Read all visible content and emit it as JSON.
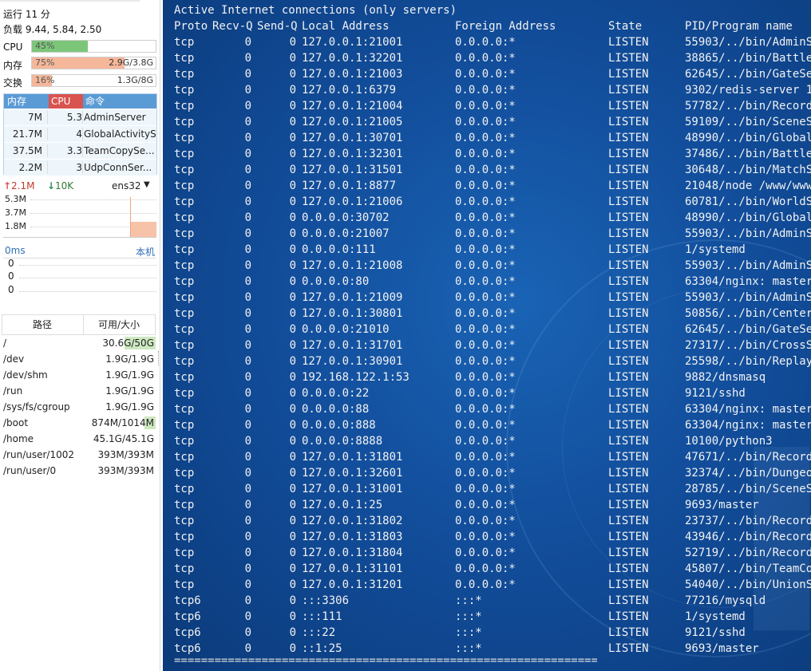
{
  "system": {
    "uptime_label": "运行 11 分",
    "load_label": "负载 9.44, 5.84, 2.50",
    "cpu": {
      "label": "CPU",
      "percent_text": "45%",
      "fraction": 0.45,
      "color": "#7cc67a"
    },
    "memory": {
      "label": "内存",
      "percent_text": "75%",
      "fraction": 0.75,
      "amount": "2.9G/3.8G",
      "color": "#f5b79a"
    },
    "swap": {
      "label": "交换",
      "percent_text": "16%",
      "fraction": 0.16,
      "amount": "1.3G/8G",
      "color": "#f5b79a"
    }
  },
  "processes": {
    "headers": [
      "内存",
      "CPU",
      "命令"
    ],
    "rows": [
      {
        "mem": "7M",
        "cpu": "5.3",
        "cmd": "AdminServer"
      },
      {
        "mem": "21.7M",
        "cpu": "4",
        "cmd": "GlobalActivityS"
      },
      {
        "mem": "37.5M",
        "cpu": "3.3",
        "cmd": "TeamCopySe..."
      },
      {
        "mem": "2.2M",
        "cpu": "3",
        "cmd": "UdpConnSer..."
      }
    ]
  },
  "network": {
    "up": "2.1M",
    "down": "10K",
    "interface": "ens32",
    "scale_labels": [
      "5.3M",
      "3.7M",
      "1.8M"
    ]
  },
  "latency": {
    "value": "0ms",
    "target": "本机",
    "rows": [
      "0",
      "0",
      "0"
    ]
  },
  "disk": {
    "headers": [
      "路径",
      "可用/大小"
    ],
    "rows": [
      {
        "path": "/",
        "size": "30.6G/50G",
        "used_fraction": 0.39
      },
      {
        "path": "/dev",
        "size": "1.9G/1.9G",
        "used_fraction": 0
      },
      {
        "path": "/dev/shm",
        "size": "1.9G/1.9G",
        "used_fraction": 0
      },
      {
        "path": "/run",
        "size": "1.9G/1.9G",
        "used_fraction": 0
      },
      {
        "path": "/sys/fs/cgroup",
        "size": "1.9G/1.9G",
        "used_fraction": 0
      },
      {
        "path": "/boot",
        "size": "874M/1014M",
        "used_fraction": 0.14
      },
      {
        "path": "/home",
        "size": "45.1G/45.1G",
        "used_fraction": 0
      },
      {
        "path": "/run/user/1002",
        "size": "393M/393M",
        "used_fraction": 0
      },
      {
        "path": "/run/user/0",
        "size": "393M/393M",
        "used_fraction": 0
      }
    ]
  },
  "terminal": {
    "title": "Active Internet connections (only servers)",
    "headers": [
      "Proto",
      "Recv-Q",
      "Send-Q",
      "Local Address",
      "Foreign Address",
      "State",
      "PID/Program name"
    ],
    "rows": [
      [
        "tcp",
        "0",
        "0",
        "127.0.0.1:21001",
        "0.0.0.0:*",
        "LISTEN",
        "55903/../bin/AdminS"
      ],
      [
        "tcp",
        "0",
        "0",
        "127.0.0.1:32201",
        "0.0.0.0:*",
        "LISTEN",
        "38865/../bin/Battle"
      ],
      [
        "tcp",
        "0",
        "0",
        "127.0.0.1:21003",
        "0.0.0.0:*",
        "LISTEN",
        "62645/../bin/GateSe"
      ],
      [
        "tcp",
        "0",
        "0",
        "127.0.0.1:6379",
        "0.0.0.0:*",
        "LISTEN",
        "9302/redis-server 1"
      ],
      [
        "tcp",
        "0",
        "0",
        "127.0.0.1:21004",
        "0.0.0.0:*",
        "LISTEN",
        "57782/../bin/Record"
      ],
      [
        "tcp",
        "0",
        "0",
        "127.0.0.1:21005",
        "0.0.0.0:*",
        "LISTEN",
        "59109/../bin/SceneS"
      ],
      [
        "tcp",
        "0",
        "0",
        "127.0.0.1:30701",
        "0.0.0.0:*",
        "LISTEN",
        "48990/../bin/Global"
      ],
      [
        "tcp",
        "0",
        "0",
        "127.0.0.1:32301",
        "0.0.0.0:*",
        "LISTEN",
        "37486/../bin/Battle"
      ],
      [
        "tcp",
        "0",
        "0",
        "127.0.0.1:31501",
        "0.0.0.0:*",
        "LISTEN",
        "30648/../bin/MatchS"
      ],
      [
        "tcp",
        "0",
        "0",
        "127.0.0.1:8877",
        "0.0.0.0:*",
        "LISTEN",
        "21048/node /www/www"
      ],
      [
        "tcp",
        "0",
        "0",
        "127.0.0.1:21006",
        "0.0.0.0:*",
        "LISTEN",
        "60781/../bin/WorldS"
      ],
      [
        "tcp",
        "0",
        "0",
        "0.0.0.0:30702",
        "0.0.0.0:*",
        "LISTEN",
        "48990/../bin/Global"
      ],
      [
        "tcp",
        "0",
        "0",
        "0.0.0.0:21007",
        "0.0.0.0:*",
        "LISTEN",
        "55903/../bin/AdminS"
      ],
      [
        "tcp",
        "0",
        "0",
        "0.0.0.0:111",
        "0.0.0.0:*",
        "LISTEN",
        "1/systemd"
      ],
      [
        "tcp",
        "0",
        "0",
        "127.0.0.1:21008",
        "0.0.0.0:*",
        "LISTEN",
        "55903/../bin/AdminS"
      ],
      [
        "tcp",
        "0",
        "0",
        "0.0.0.0:80",
        "0.0.0.0:*",
        "LISTEN",
        "63304/nginx: master"
      ],
      [
        "tcp",
        "0",
        "0",
        "127.0.0.1:21009",
        "0.0.0.0:*",
        "LISTEN",
        "55903/../bin/AdminS"
      ],
      [
        "tcp",
        "0",
        "0",
        "127.0.0.1:30801",
        "0.0.0.0:*",
        "LISTEN",
        "50856/../bin/Center"
      ],
      [
        "tcp",
        "0",
        "0",
        "0.0.0.0:21010",
        "0.0.0.0:*",
        "LISTEN",
        "62645/../bin/GateSe"
      ],
      [
        "tcp",
        "0",
        "0",
        "127.0.0.1:31701",
        "0.0.0.0:*",
        "LISTEN",
        "27317/../bin/CrossS"
      ],
      [
        "tcp",
        "0",
        "0",
        "127.0.0.1:30901",
        "0.0.0.0:*",
        "LISTEN",
        "25598/../bin/Replay"
      ],
      [
        "tcp",
        "0",
        "0",
        "192.168.122.1:53",
        "0.0.0.0:*",
        "LISTEN",
        "9882/dnsmasq"
      ],
      [
        "tcp",
        "0",
        "0",
        "0.0.0.0:22",
        "0.0.0.0:*",
        "LISTEN",
        "9121/sshd"
      ],
      [
        "tcp",
        "0",
        "0",
        "0.0.0.0:88",
        "0.0.0.0:*",
        "LISTEN",
        "63304/nginx: master"
      ],
      [
        "tcp",
        "0",
        "0",
        "0.0.0.0:888",
        "0.0.0.0:*",
        "LISTEN",
        "63304/nginx: master"
      ],
      [
        "tcp",
        "0",
        "0",
        "0.0.0.0:8888",
        "0.0.0.0:*",
        "LISTEN",
        "10100/python3"
      ],
      [
        "tcp",
        "0",
        "0",
        "127.0.0.1:31801",
        "0.0.0.0:*",
        "LISTEN",
        "47671/../bin/Record"
      ],
      [
        "tcp",
        "0",
        "0",
        "127.0.0.1:32601",
        "0.0.0.0:*",
        "LISTEN",
        "32374/../bin/Dungeo"
      ],
      [
        "tcp",
        "0",
        "0",
        "127.0.0.1:31001",
        "0.0.0.0:*",
        "LISTEN",
        "28785/../bin/SceneS"
      ],
      [
        "tcp",
        "0",
        "0",
        "127.0.0.1:25",
        "0.0.0.0:*",
        "LISTEN",
        "9693/master"
      ],
      [
        "tcp",
        "0",
        "0",
        "127.0.0.1:31802",
        "0.0.0.0:*",
        "LISTEN",
        "23737/../bin/Record"
      ],
      [
        "tcp",
        "0",
        "0",
        "127.0.0.1:31803",
        "0.0.0.0:*",
        "LISTEN",
        "43946/../bin/Record"
      ],
      [
        "tcp",
        "0",
        "0",
        "127.0.0.1:31804",
        "0.0.0.0:*",
        "LISTEN",
        "52719/../bin/Record"
      ],
      [
        "tcp",
        "0",
        "0",
        "127.0.0.1:31101",
        "0.0.0.0:*",
        "LISTEN",
        "45807/../bin/TeamCo"
      ],
      [
        "tcp",
        "0",
        "0",
        "127.0.0.1:31201",
        "0.0.0.0:*",
        "LISTEN",
        "54040/../bin/UnionS"
      ],
      [
        "tcp6",
        "0",
        "0",
        ":::3306",
        ":::*",
        "LISTEN",
        "77216/mysqld"
      ],
      [
        "tcp6",
        "0",
        "0",
        ":::111",
        ":::*",
        "LISTEN",
        "1/systemd"
      ],
      [
        "tcp6",
        "0",
        "0",
        ":::22",
        ":::*",
        "LISTEN",
        "9121/sshd"
      ],
      [
        "tcp6",
        "0",
        "0",
        "::1:25",
        ":::*",
        "LISTEN",
        "9693/master"
      ]
    ],
    "separator": "=========================================================================="
  },
  "colors": {
    "up_arrow": "#d9534f",
    "down_arrow": "#2e8b57",
    "proc_cpu_header": "#d9534f",
    "accent": "#5a9bd5"
  },
  "icons": {
    "up": "arrow-up-icon",
    "down": "arrow-down-icon",
    "dropdown": "caret-down-icon"
  }
}
